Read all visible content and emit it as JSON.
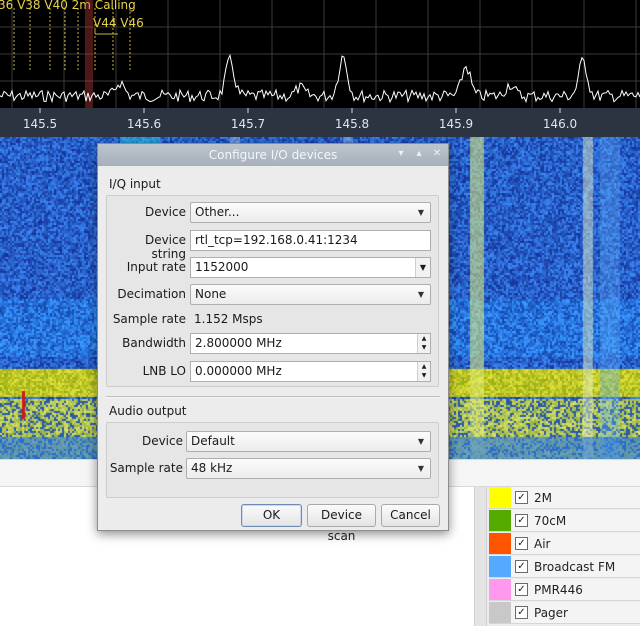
{
  "spectrum": {
    "bookmark_labels": [
      {
        "text": "36  V38  V40 2m Calling"
      },
      {
        "text": "V44  V46"
      }
    ],
    "freq_ticks": [
      "145.5",
      "145.6",
      "145.7",
      "145.8",
      "145.9",
      "146.0"
    ],
    "colors": {
      "background": "#000000",
      "grid": "#3a3a3a",
      "trace": "#ffffff",
      "label": "#e8d24a",
      "tick_band": "#2b3440"
    }
  },
  "dialog": {
    "title": "Configure I/O devices",
    "title_buttons": [
      "chevron-down-icon",
      "chevron-up-icon",
      "close-icon"
    ],
    "iq_section": "I/Q input",
    "audio_section": "Audio output",
    "iq": {
      "device": {
        "label": "Device",
        "value": "Other..."
      },
      "device_string": {
        "label": "Device string",
        "value": "rtl_tcp=192.168.0.41:1234"
      },
      "input_rate": {
        "label": "Input rate",
        "value": "1152000"
      },
      "decimation": {
        "label": "Decimation",
        "value": "None"
      },
      "sample_rate": {
        "label": "Sample rate",
        "value": "1.152 Msps"
      },
      "bandwidth": {
        "label": "Bandwidth",
        "value": "2.800000 MHz"
      },
      "lnb_lo": {
        "label": "LNB LO",
        "value": "0.000000 MHz"
      }
    },
    "audio": {
      "device": {
        "label": "Device",
        "value": "Default"
      },
      "sample_rate": {
        "label": "Sample rate",
        "value": "48 kHz"
      }
    },
    "buttons": {
      "ok": "OK",
      "device_scan": "Device scan",
      "cancel": "Cancel"
    }
  },
  "bands": [
    {
      "name": "2M",
      "color": "#ffff00",
      "checked": true
    },
    {
      "name": "70cM",
      "color": "#55aa00",
      "checked": true
    },
    {
      "name": "Air",
      "color": "#ff5500",
      "checked": true
    },
    {
      "name": "Broadcast FM",
      "color": "#55aaff",
      "checked": true
    },
    {
      "name": "PMR446",
      "color": "#ff99ee",
      "checked": true
    },
    {
      "name": "Pager",
      "color": "#c8c8c8",
      "checked": true
    }
  ]
}
